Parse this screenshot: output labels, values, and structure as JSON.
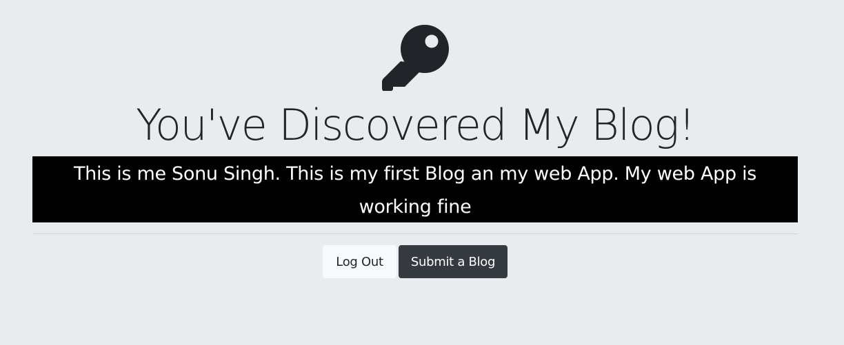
{
  "hero": {
    "icon": "key-icon",
    "title": "You've Discovered My Blog!",
    "lead": "This is me Sonu Singh. This is my first Blog an my web App. My web App is working fine"
  },
  "actions": {
    "logout_label": "Log Out",
    "submit_label": "Submit a Blog"
  },
  "colors": {
    "background": "#e9ecef",
    "text": "#212529",
    "lead_background": "#000000",
    "lead_text": "#ffffff",
    "button_light": "#f8f9fa",
    "button_dark": "#343a40"
  }
}
